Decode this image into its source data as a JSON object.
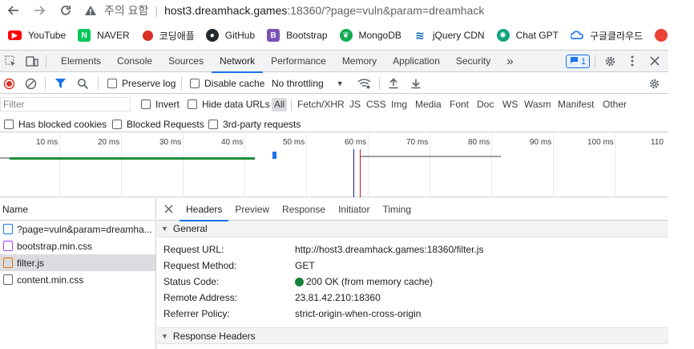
{
  "address_bar": {
    "security_label": "주의 요함",
    "url_host": "host3.dreamhack.games",
    "url_rest": ":18360/?page=vuln&param=dreamhack"
  },
  "bookmarks": [
    {
      "label": "YouTube",
      "icon": "youtube-icon",
      "color": "#ff0000"
    },
    {
      "label": "NAVER",
      "icon": "naver-icon",
      "color": "#03c75a"
    },
    {
      "label": "코딩애플",
      "icon": "apple-icon",
      "color": "#d93025"
    },
    {
      "label": "GitHub",
      "icon": "github-icon",
      "color": "#24292f"
    },
    {
      "label": "Bootstrap",
      "icon": "bootstrap-icon",
      "color": "#7952b3"
    },
    {
      "label": "MongoDB",
      "icon": "mongodb-icon",
      "color": "#13aa52"
    },
    {
      "label": "jQuery CDN",
      "icon": "jquery-icon",
      "color": "#0769ad"
    },
    {
      "label": "Chat GPT",
      "icon": "chatgpt-icon",
      "color": "#10a37f"
    },
    {
      "label": "구글클라우드",
      "icon": "google-cloud-icon",
      "color": "#4285f4"
    }
  ],
  "devtools": {
    "tabs": [
      "Elements",
      "Console",
      "Sources",
      "Network",
      "Performance",
      "Memory",
      "Application",
      "Security"
    ],
    "active_tab": "Network",
    "more_tabs": "»",
    "issues_count": "1",
    "toolbar": {
      "preserve_log": "Preserve log",
      "disable_cache": "Disable cache",
      "throttling": "No throttling"
    },
    "filter": {
      "placeholder": "Filter",
      "invert": "Invert",
      "hide_data_urls": "Hide data URLs",
      "types": [
        "All",
        "Fetch/XHR",
        "JS",
        "CSS",
        "Img",
        "Media",
        "Font",
        "Doc",
        "WS",
        "Wasm",
        "Manifest",
        "Other"
      ],
      "active_type": "All",
      "has_blocked_cookies": "Has blocked cookies",
      "blocked_requests": "Blocked Requests",
      "third_party": "3rd-party requests"
    },
    "timeline": {
      "ticks": [
        "10 ms",
        "20 ms",
        "30 ms",
        "40 ms",
        "50 ms",
        "60 ms",
        "70 ms",
        "80 ms",
        "90 ms",
        "100 ms",
        "110"
      ]
    },
    "requests": {
      "header": "Name",
      "items": [
        {
          "name": "?page=vuln&param=dreamha...",
          "icon": "document-icon",
          "color": "#1a73e8"
        },
        {
          "name": "bootstrap.min.css",
          "icon": "stylesheet-icon",
          "color": "#a142f4"
        },
        {
          "name": "filter.js",
          "icon": "script-icon",
          "color": "#e37400"
        },
        {
          "name": "content.min.css",
          "icon": "blank-file-icon",
          "color": "#5f6368"
        }
      ],
      "selected_index": 2
    },
    "detail": {
      "tabs": [
        "Headers",
        "Preview",
        "Response",
        "Initiator",
        "Timing"
      ],
      "active_tab": "Headers",
      "general_title": "General",
      "general": [
        {
          "key": "Request URL:",
          "value": "http://host3.dreamhack.games:18360/filter.js"
        },
        {
          "key": "Request Method:",
          "value": "GET"
        },
        {
          "key": "Status Code:",
          "value": "200 OK (from memory cache)"
        },
        {
          "key": "Remote Address:",
          "value": "23.81.42.210:18360"
        },
        {
          "key": "Referrer Policy:",
          "value": "strict-origin-when-cross-origin"
        }
      ],
      "response_headers_title": "Response Headers"
    }
  }
}
